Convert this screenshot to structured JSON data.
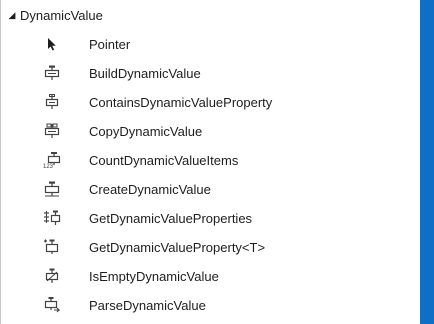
{
  "toolbox": {
    "group": {
      "label": "DynamicValue",
      "expanded_glyph": "◢"
    },
    "items": [
      {
        "label": "Pointer",
        "icon": "pointer-icon"
      },
      {
        "label": "BuildDynamicValue",
        "icon": "build-dynamic-value-icon"
      },
      {
        "label": "ContainsDynamicValueProperty",
        "icon": "contains-property-icon"
      },
      {
        "label": "CopyDynamicValue",
        "icon": "copy-dynamic-value-icon"
      },
      {
        "label": "CountDynamicValueItems",
        "icon": "count-items-icon"
      },
      {
        "label": "CreateDynamicValue",
        "icon": "create-dynamic-value-icon"
      },
      {
        "label": "GetDynamicValueProperties",
        "icon": "get-properties-icon"
      },
      {
        "label": "GetDynamicValueProperty<T>",
        "icon": "get-property-icon"
      },
      {
        "label": "IsEmptyDynamicValue",
        "icon": "is-empty-icon"
      },
      {
        "label": "ParseDynamicValue",
        "icon": "parse-dynamic-value-icon"
      }
    ]
  }
}
